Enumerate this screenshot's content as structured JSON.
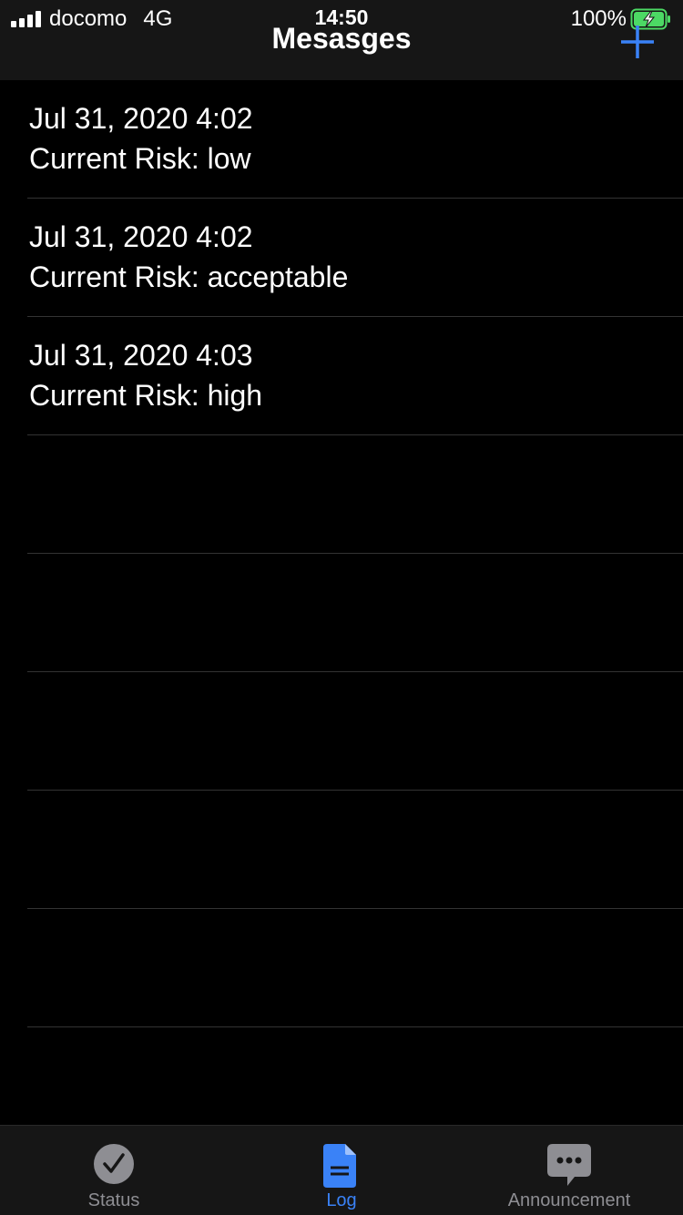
{
  "status_bar": {
    "carrier": "docomo",
    "network": "4G",
    "time": "14:50",
    "battery": "100%"
  },
  "nav": {
    "title": "Mesasges",
    "add_icon": "plus-icon"
  },
  "messages": [
    {
      "date": "Jul 31, 2020 4:02",
      "risk": "Current Risk: low"
    },
    {
      "date": "Jul 31, 2020 4:02",
      "risk": "Current Risk: acceptable"
    },
    {
      "date": "Jul 31, 2020 4:03",
      "risk": "Current Risk: high"
    },
    {
      "date": "",
      "risk": ""
    },
    {
      "date": "",
      "risk": ""
    },
    {
      "date": "",
      "risk": ""
    },
    {
      "date": "",
      "risk": ""
    },
    {
      "date": "",
      "risk": ""
    }
  ],
  "tabs": [
    {
      "label": "Status",
      "icon": "checkmark-circle-icon",
      "active": false
    },
    {
      "label": "Log",
      "icon": "document-icon",
      "active": true
    },
    {
      "label": "Announcement",
      "icon": "chat-bubble-icon",
      "active": false
    }
  ],
  "colors": {
    "accent": "#3a82f7",
    "inactive": "#8e8e93",
    "battery_green": "#4cd964",
    "bars_background": "#161616",
    "separator": "#333333"
  }
}
